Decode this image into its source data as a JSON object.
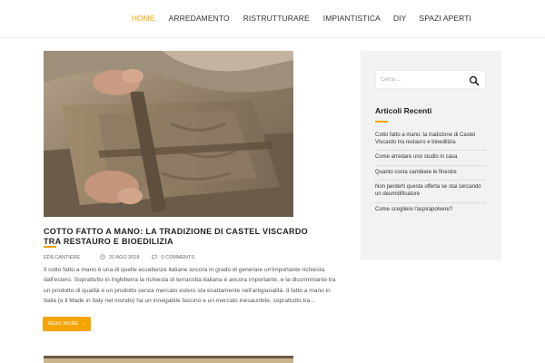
{
  "nav": {
    "items": [
      {
        "label": "HOME",
        "active": true
      },
      {
        "label": "ARREDAMENTO",
        "active": false
      },
      {
        "label": "RISTRUTTURARE",
        "active": false
      },
      {
        "label": "IMPIANTISTICA",
        "active": false
      },
      {
        "label": "DIY",
        "active": false
      },
      {
        "label": "SPAZI APERTI",
        "active": false
      }
    ]
  },
  "post": {
    "title": "COTTO FATTO A MANO: LA TRADIZIONE DI CASTEL VISCARDO TRA RESTAURO E BIOEDILIZIA",
    "author": "EDILCANTIERE",
    "date": "20 AGO 2018",
    "comments": "0 COMMENTS",
    "excerpt": "Il cotto fatto a mano è una di quelle eccellenze italiane ancora in grado di generare un'importante richiesta dall'estero. Soprattutto in Inghilterra la richiesta di terracotta italiana è ancora importante, e la discriminante tra un prodotto di qualità e un prodotto senza mercato estero  sta esattamente nell'artigianalità. Il fatto a mano in Italia (e il Made in Italy nel mondo) ha un innegabile fascino e un mercato inesauribile, soprattutto tra…",
    "read_more": "READ MORE",
    "read_more_arrow": "›"
  },
  "sidebar": {
    "search": {
      "placeholder": "Cerca ..."
    },
    "recent_title": "Articoli Recenti",
    "recent": [
      "Cotto fatto a mano: la tradizione di Castel Viscardo tra restauro e bioedilizia",
      "Come arredare uno studio in casa",
      "Quanto costa cambiare le finestre",
      "Non perderti questa offerta se stai cercando un deumidificatore",
      "Come scegliere l'aspirapolvere?"
    ]
  },
  "colors": {
    "accent": "#f5a400",
    "sidebar_bg": "#f2f2f2"
  },
  "icons": {
    "date": "clock-icon",
    "comments": "comment-icon",
    "search": "search-icon"
  }
}
